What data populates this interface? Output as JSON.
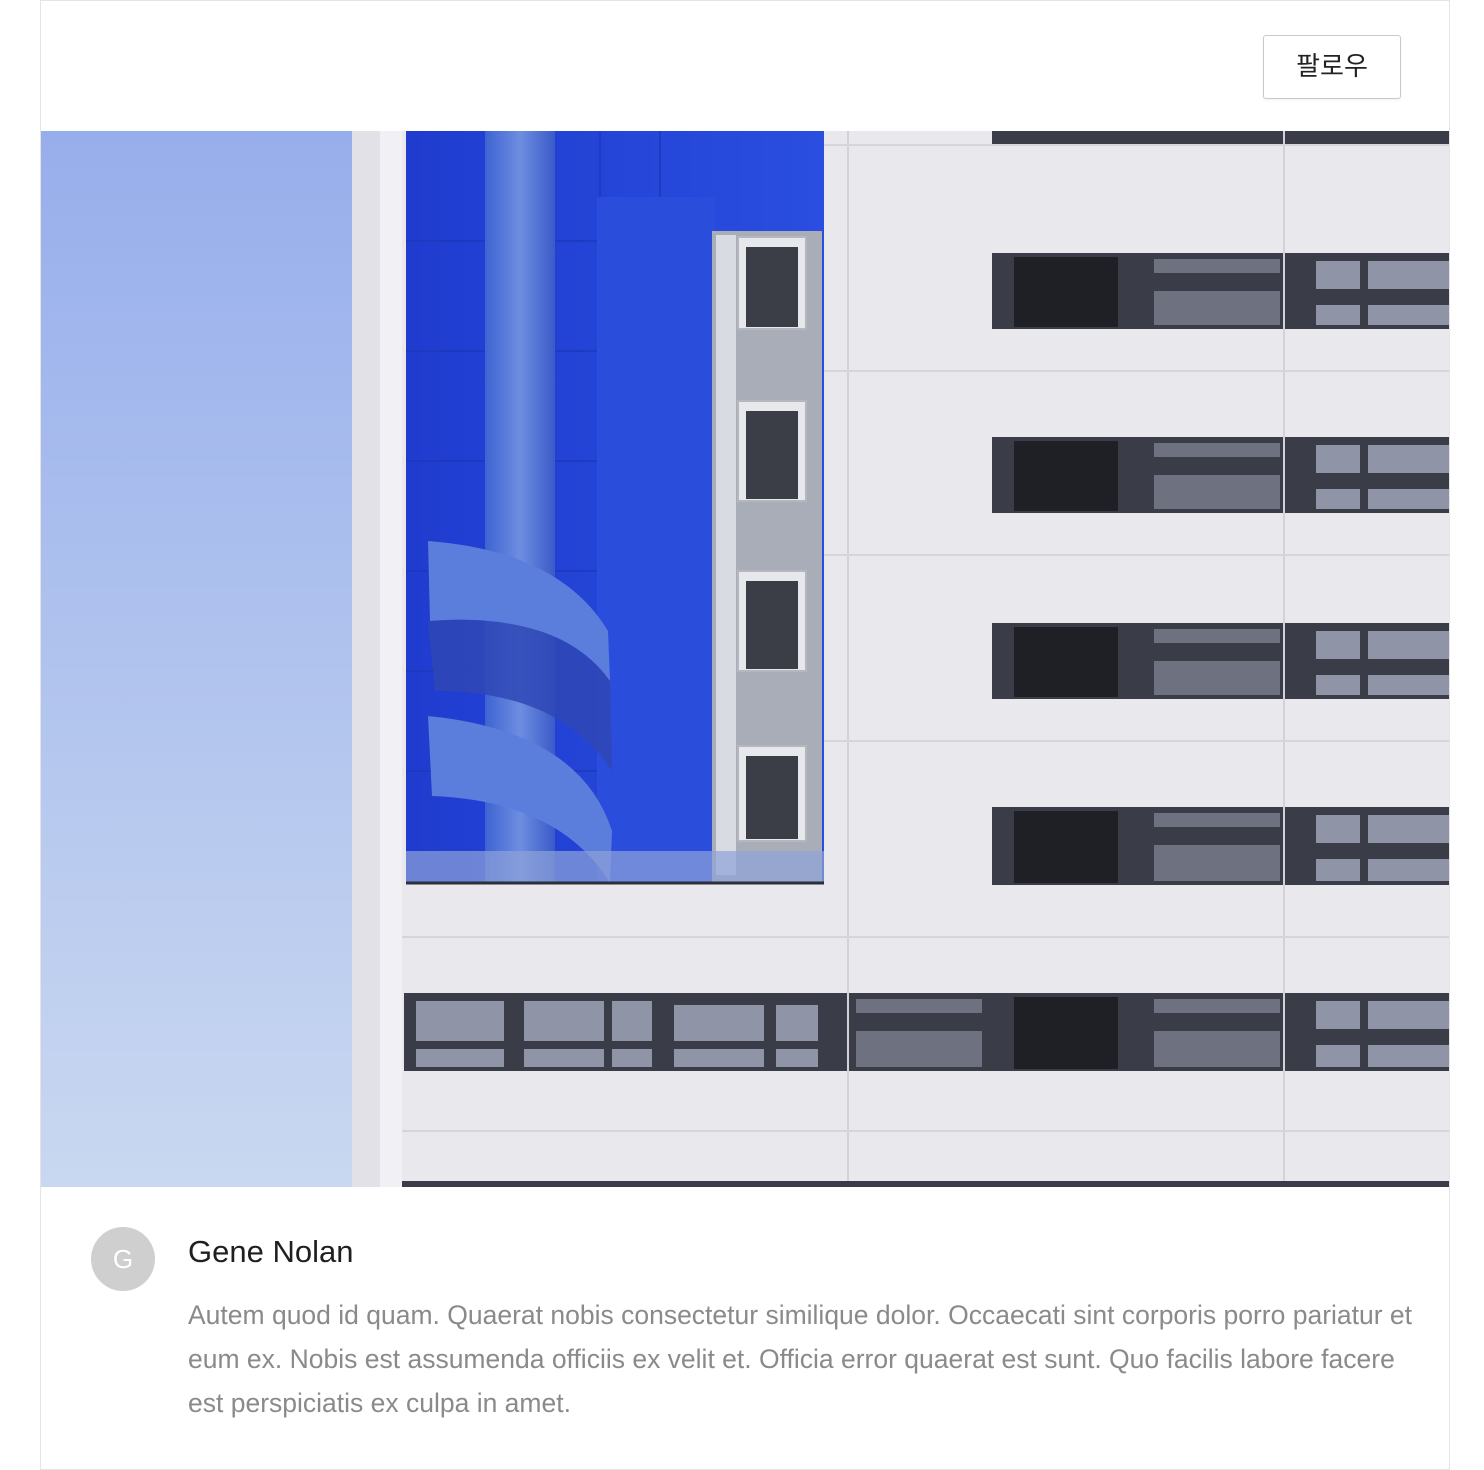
{
  "header": {
    "follow_label": "팔로우"
  },
  "hero": {
    "alt": "Blue and white modern building facade with spiral staircase",
    "colors": {
      "sky_top": "#97aeec",
      "sky_bottom": "#c9d8f0",
      "facade": "#e9e8ec",
      "accent_blue": "#2645d6",
      "window_dark": "#3a3d48"
    }
  },
  "post": {
    "avatar_initial": "G",
    "author": "Gene Nolan",
    "text": "Autem quod id quam. Quaerat nobis consectetur similique dolor. Occaecati sint corporis porro pariatur et eum ex. Nobis est assumenda officiis ex velit et. Officia error quaerat est sunt. Quo facilis labore facere est perspiciatis ex culpa in amet."
  }
}
